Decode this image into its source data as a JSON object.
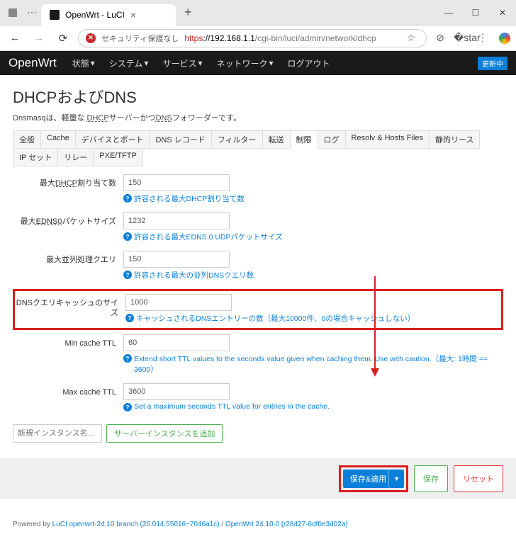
{
  "browser": {
    "tab_title": "OpenWrt - LuCI",
    "security_text": "セキュリティ保護なし",
    "url_proto": "https",
    "url_host": "://192.168.1.1",
    "url_path": "/cgi-bin/luci/admin/network/dhcp"
  },
  "header": {
    "logo": "OpenWrt",
    "menus": [
      "状態",
      "システム",
      "サービス",
      "ネットワーク",
      "ログアウト"
    ],
    "badge": "更新中"
  },
  "page": {
    "title": "DHCPおよびDNS",
    "desc_pre": "Dnsmasqは、軽量な ",
    "desc_u1": "DHCP",
    "desc_mid": "サーバーかつ",
    "desc_u2": "DNS",
    "desc_post": "フォワーダーです。"
  },
  "tabs": [
    "全般",
    "Cache",
    "デバイスとポート",
    "DNS レコード",
    "フィルター",
    "転送",
    "制限",
    "ログ",
    "Resolv & Hosts Files",
    "静的リース",
    "IP セット",
    "リレー",
    "PXE/TFTP"
  ],
  "active_tab": 6,
  "fields": {
    "max_dhcp": {
      "label_pre": "最大",
      "label_u": "DHCP",
      "label_post": "割り当て数",
      "value": "150",
      "help": "許容される最大DHCP割り当て数"
    },
    "max_edns": {
      "label_pre": "最大",
      "label_u": "EDNS0",
      "label_post": "パケットサイズ",
      "value": "1232",
      "help": "許容される最大EDNS.0 UDPパケットサイズ"
    },
    "max_conc": {
      "label": "最大並列処理クエリ",
      "value": "150",
      "help": "許容される最大の並列DNSクエリ数"
    },
    "cache_size": {
      "label": "DNSクエリキャッシュのサイズ",
      "value": "1000",
      "help": "キャッシュされるDNSエントリーの数（最大10000件、0の場合キャッシュしない）"
    },
    "min_ttl": {
      "label": "Min cache TTL",
      "value": "60",
      "help": "Extend short TTL values to the seconds value given when caching them. Use with caution.（最大: 1時間 == 3600）"
    },
    "max_ttl": {
      "label": "Max cache TTL",
      "value": "3600",
      "help": "Set a maximum seconds TTL value for entries in the cache."
    }
  },
  "add": {
    "placeholder": "新規インスタンス名…",
    "button": "サーバーインスタンスを追加"
  },
  "actions": {
    "save_apply": "保存&適用",
    "save": "保存",
    "reset": "リセット"
  },
  "footer": {
    "text": "Powered by ",
    "link1": "LuCI openwrt-24.10 branch (25.014.55016~7046a1c)",
    "sep": " / ",
    "link2": "OpenWrt 24.10.0 (r28427-6df0e3d02a)"
  }
}
